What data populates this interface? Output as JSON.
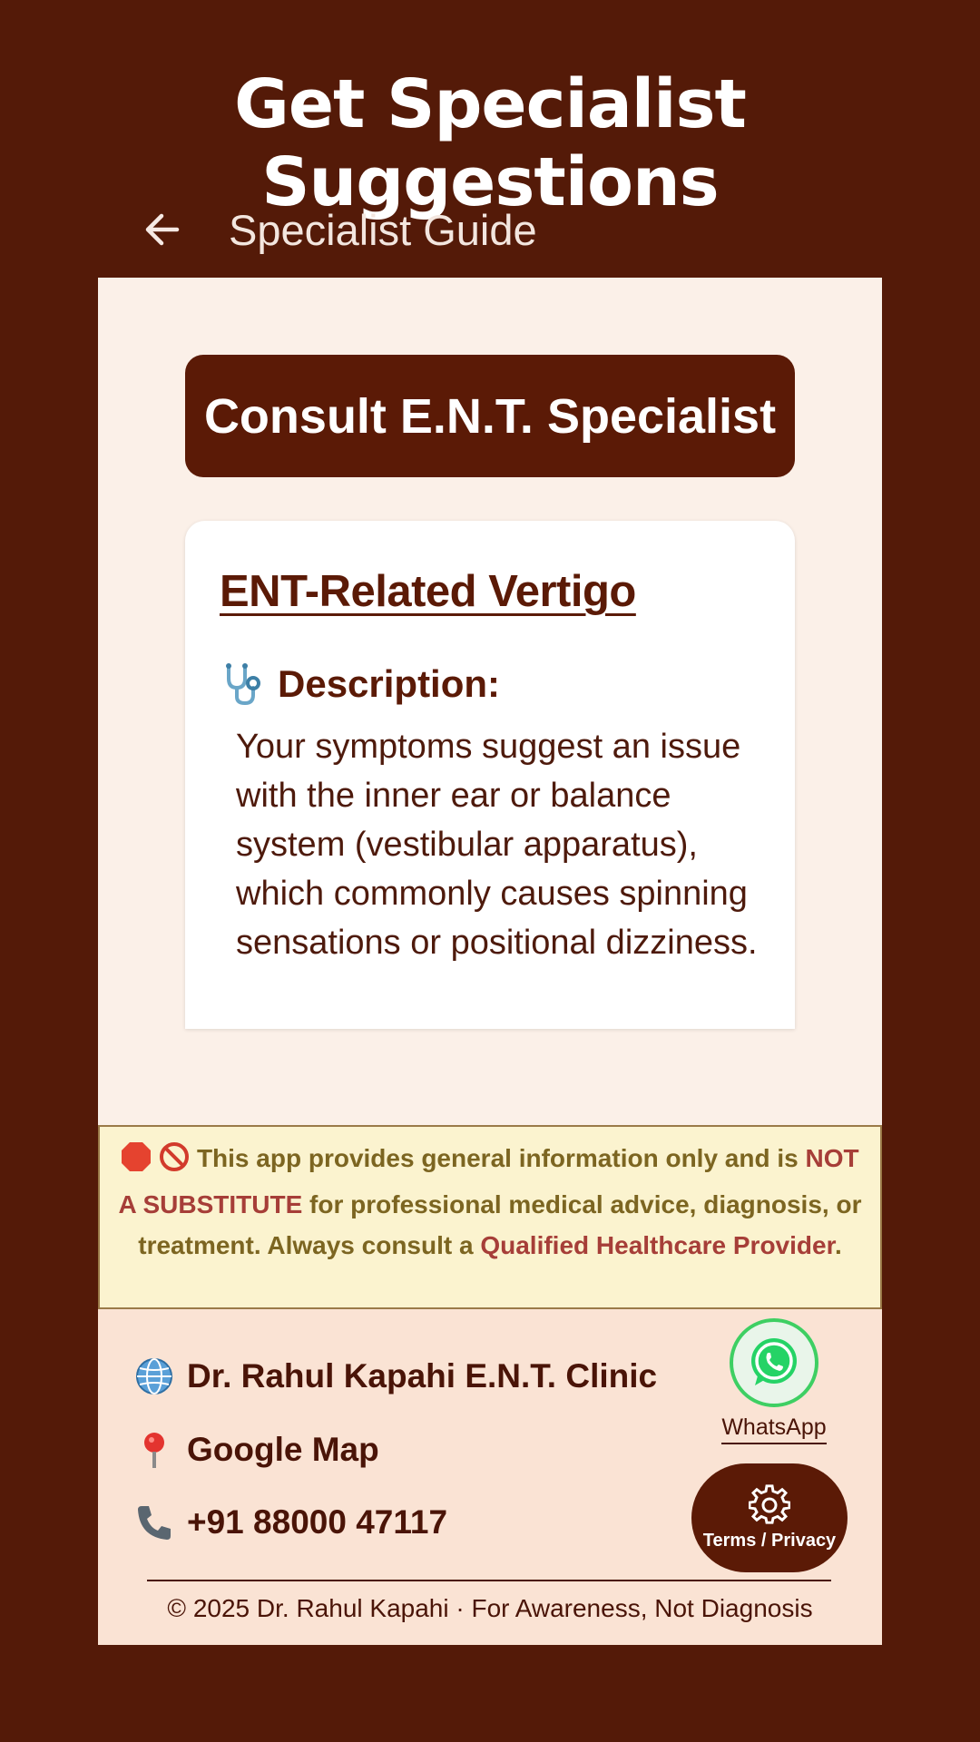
{
  "promo": {
    "title": "Get Specialist Suggestions"
  },
  "appbar": {
    "title": "Specialist Guide"
  },
  "banner": {
    "text": "Consult E.N.T. Specialist"
  },
  "card": {
    "heading": "ENT-Related Vertigo",
    "description_label": "Description:",
    "description_text": "Your symptoms suggest an issue with the inner ear or balance system (vestibular apparatus), which commonly causes spinning sensations or positional dizziness."
  },
  "disclaimer": {
    "part1": "This app provides general information only and is ",
    "highlight1": "NOT A SUBSTITUTE",
    "part2": " for professional medical advice, diagnosis, or treatment. Always consult a ",
    "highlight2": "Qualified Healthcare Provider",
    "part3": "."
  },
  "footer": {
    "clinic_link": "Dr. Rahul Kapahi E.N.T. Clinic",
    "map_link": "Google Map",
    "phone": "+91 88000 47117",
    "whatsapp_label": "WhatsApp",
    "terms_label": "Terms / Privacy",
    "copyright": "© 2025 Dr. Rahul Kapahi · For Awareness, Not Diagnosis"
  },
  "colors": {
    "background": "#541a08",
    "panel": "#fbf0e8",
    "accent": "#5b1a06",
    "disclaimer_bg": "#fbf3cf",
    "highlight": "#a63e38",
    "whatsapp": "#3ecf63"
  },
  "icons": [
    "back-arrow-icon",
    "stethoscope-icon",
    "stop-sign-icon",
    "no-entry-icon",
    "globe-icon",
    "map-pin-icon",
    "phone-icon",
    "whatsapp-icon",
    "gear-icon"
  ]
}
